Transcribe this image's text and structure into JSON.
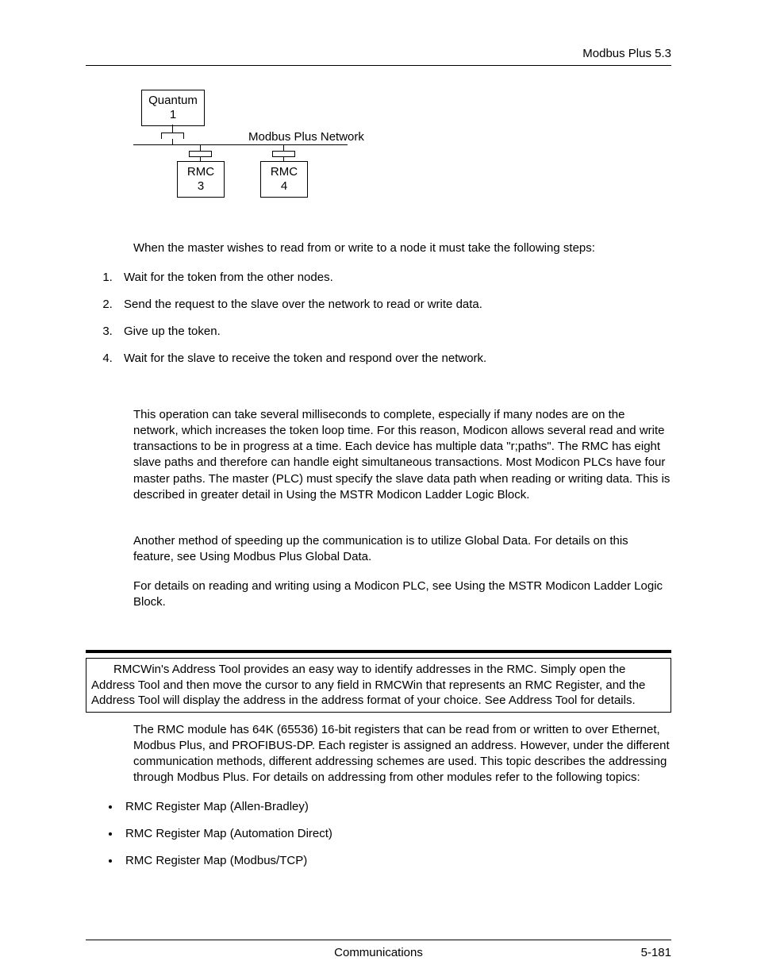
{
  "header": {
    "right": "Modbus Plus  5.3"
  },
  "diagram": {
    "quantum": "Quantum\n1",
    "rmc3": "RMC\n3",
    "rmc4": "RMC\n4",
    "netlabel": "Modbus Plus Network"
  },
  "intro_sentence": "When the master wishes to read from or write to a node it must take the following steps:",
  "steps": [
    "Wait for the token from the other nodes.",
    "Send the request to the slave over the network to read or write data.",
    "Give up the token.",
    "Wait for the slave to receive the token and respond over the network."
  ],
  "para_operation": "This operation can take several milliseconds to complete, especially if many nodes are on the network, which increases the token loop time. For this reason, Modicon allows several read and write transactions to be in progress at a time. Each device has multiple data \"r;paths\". The RMC has eight slave paths and therefore can handle eight simultaneous transactions. Most Modicon PLCs have four master paths. The master (PLC) must specify the slave data path when reading or writing data. This is described in greater detail in Using the MSTR Modicon Ladder Logic Block.",
  "para_global": "Another method of speeding up the communication is to utilize Global Data. For details on this feature, see Using Modbus Plus Global Data.",
  "para_mstr": "For details on reading and writing using a Modicon PLC, see Using the MSTR Modicon Ladder Logic Block.",
  "tipbox": "RMCWin's Address Tool provides an easy way to identify addresses in the RMC. Simply open the Address Tool and then move the cursor to any field in RMCWin that represents an RMC Register, and the Address Tool will display the address in the address format of your choice. See Address Tool for details.",
  "para_registers": "The RMC module has 64K (65536) 16-bit registers that can be read from or written to over Ethernet, Modbus Plus, and PROFIBUS-DP. Each register is assigned an address. However, under the different communication methods, different addressing schemes are used. This topic describes the addressing through Modbus Plus. For details on addressing from other modules refer to the following topics:",
  "bullets": [
    "RMC Register Map (Allen-Bradley)",
    "RMC Register Map (Automation Direct)",
    "RMC Register Map (Modbus/TCP)"
  ],
  "footer": {
    "center": "Communications",
    "right": "5-181"
  }
}
